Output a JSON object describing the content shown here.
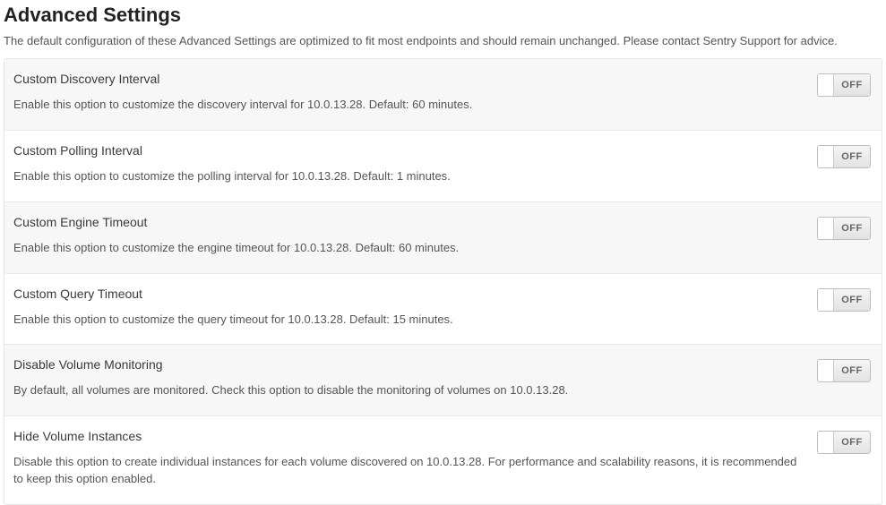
{
  "header": {
    "title": "Advanced Settings",
    "subtitle": "The default configuration of these Advanced Settings are optimized to fit most endpoints and should remain unchanged. Please contact Sentry Support for advice."
  },
  "toggle_off_label": "OFF",
  "settings": [
    {
      "title": "Custom Discovery Interval",
      "description": "Enable this option to customize the discovery interval for 10.0.13.28. Default: 60 minutes."
    },
    {
      "title": "Custom Polling Interval",
      "description": "Enable this option to customize the polling interval for 10.0.13.28. Default: 1 minutes."
    },
    {
      "title": "Custom Engine Timeout",
      "description": "Enable this option to customize the engine timeout for 10.0.13.28. Default: 60 minutes."
    },
    {
      "title": "Custom Query Timeout",
      "description": "Enable this option to customize the query timeout for 10.0.13.28. Default: 15 minutes."
    },
    {
      "title": "Disable Volume Monitoring",
      "description": "By default, all volumes are monitored. Check this option to disable the monitoring of volumes on 10.0.13.28."
    },
    {
      "title": "Hide Volume Instances",
      "description": "Disable this option to create individual instances for each volume discovered on 10.0.13.28. For performance and scalability reasons, it is recommended to keep this option enabled."
    }
  ]
}
